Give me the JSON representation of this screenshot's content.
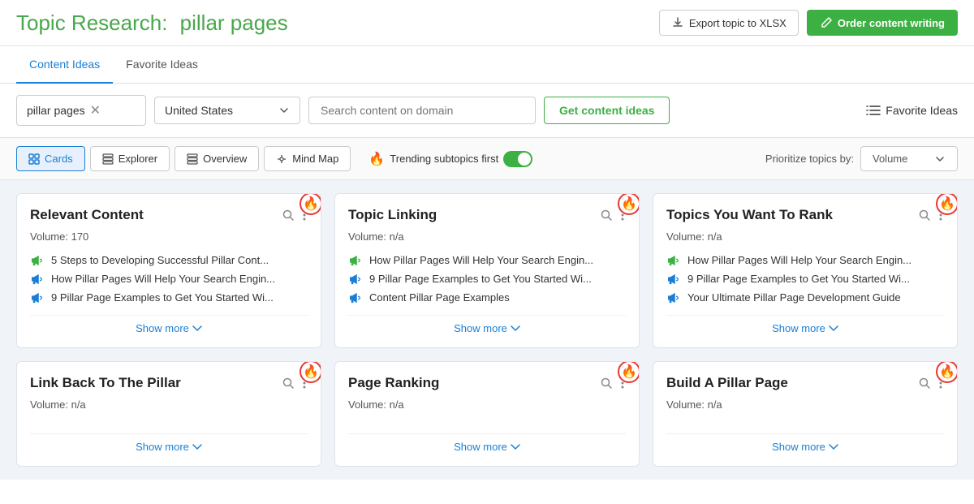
{
  "header": {
    "title_static": "Topic Research:",
    "title_highlight": "pillar pages",
    "export_label": "Export topic to XLSX",
    "order_label": "Order content writing"
  },
  "tabs": [
    {
      "id": "content-ideas",
      "label": "Content Ideas",
      "active": true
    },
    {
      "id": "favorite-ideas",
      "label": "Favorite Ideas",
      "active": false
    }
  ],
  "search": {
    "keyword_value": "pillar pages",
    "country_value": "United States",
    "domain_placeholder": "Search content on domain",
    "get_ideas_label": "Get content ideas",
    "fav_ideas_label": "Favorite Ideas"
  },
  "view_bar": {
    "views": [
      {
        "id": "cards",
        "label": "Cards",
        "active": true
      },
      {
        "id": "explorer",
        "label": "Explorer",
        "active": false
      },
      {
        "id": "overview",
        "label": "Overview",
        "active": false
      },
      {
        "id": "mind-map",
        "label": "Mind Map",
        "active": false
      }
    ],
    "trending_label": "Trending subtopics first",
    "prioritize_label": "Prioritize topics by:",
    "priority_value": "Volume"
  },
  "cards": [
    {
      "id": "relevant-content",
      "title": "Relevant Content",
      "volume": "Volume: 170",
      "trending": true,
      "items": [
        {
          "type": "green",
          "text": "5 Steps to Developing Successful Pillar Cont..."
        },
        {
          "type": "blue",
          "text": "How Pillar Pages Will Help Your Search Engin..."
        },
        {
          "type": "blue",
          "text": "9 Pillar Page Examples to Get You Started Wi..."
        }
      ],
      "show_more": "Show more"
    },
    {
      "id": "topic-linking",
      "title": "Topic Linking",
      "volume": "Volume: n/a",
      "trending": true,
      "items": [
        {
          "type": "green",
          "text": "How Pillar Pages Will Help Your Search Engin..."
        },
        {
          "type": "blue",
          "text": "9 Pillar Page Examples to Get You Started Wi..."
        },
        {
          "type": "blue",
          "text": "Content Pillar Page Examples"
        }
      ],
      "show_more": "Show more"
    },
    {
      "id": "topics-you-want-to-rank",
      "title": "Topics You Want To Rank",
      "volume": "Volume: n/a",
      "trending": true,
      "items": [
        {
          "type": "green",
          "text": "How Pillar Pages Will Help Your Search Engin..."
        },
        {
          "type": "blue",
          "text": "9 Pillar Page Examples to Get You Started Wi..."
        },
        {
          "type": "blue",
          "text": "Your Ultimate Pillar Page Development Guide"
        }
      ],
      "show_more": "Show more"
    },
    {
      "id": "link-back-to-pillar",
      "title": "Link Back To The Pillar",
      "volume": "Volume: n/a",
      "trending": true,
      "items": [],
      "show_more": "Show more"
    },
    {
      "id": "page-ranking",
      "title": "Page Ranking",
      "volume": "Volume: n/a",
      "trending": true,
      "items": [],
      "show_more": "Show more"
    },
    {
      "id": "build-a-pillar-page",
      "title": "Build A Pillar Page",
      "volume": "Volume: n/a",
      "trending": true,
      "items": [],
      "show_more": "Show more"
    }
  ]
}
